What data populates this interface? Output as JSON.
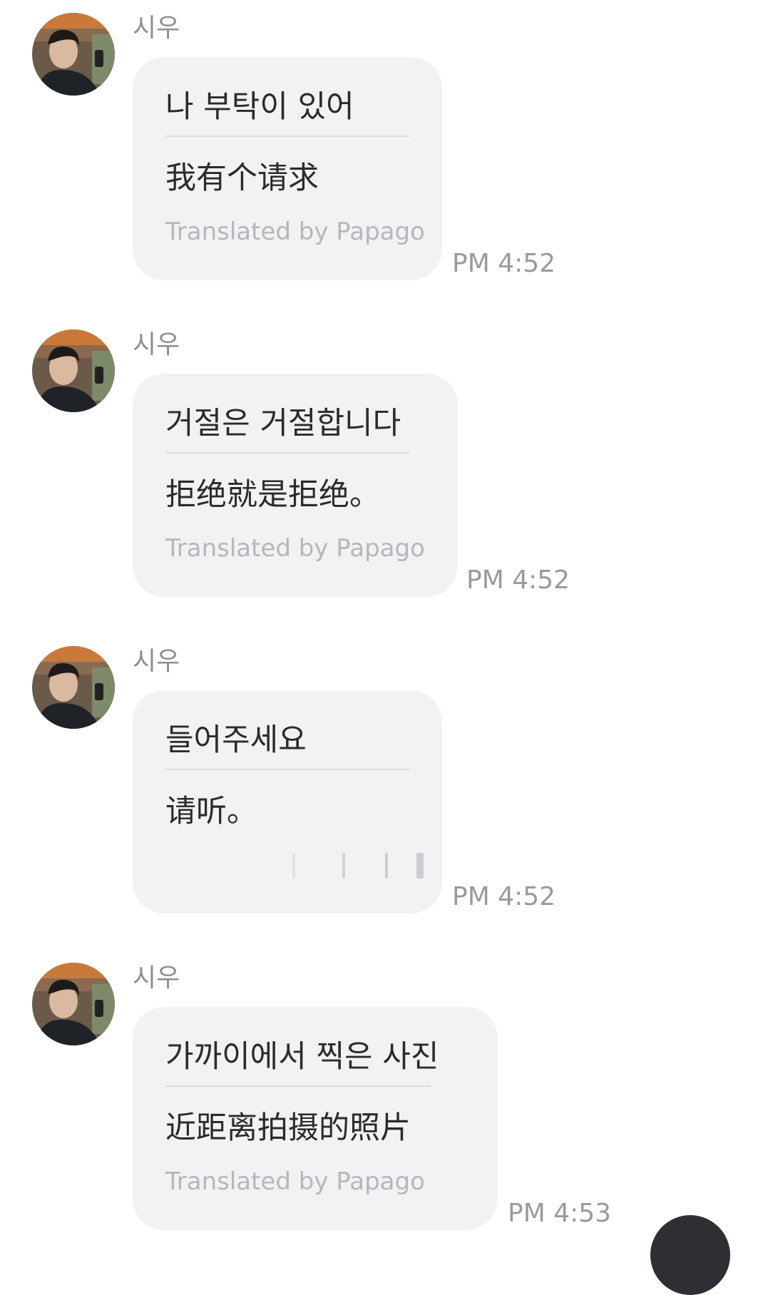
{
  "messages": [
    {
      "sender": "시우",
      "original": "나 부탁이 있어",
      "translation": "我有个请求",
      "credit": "Translated by Papago",
      "time": "PM 4:52"
    },
    {
      "sender": "시우",
      "original": "거절은 거절합니다",
      "translation": "拒绝就是拒绝。",
      "credit": "Translated by Papago",
      "time": "PM 4:52"
    },
    {
      "sender": "시우",
      "original": "들어주세요",
      "translation": "请听。",
      "credit": "",
      "time": "PM 4:52"
    },
    {
      "sender": "시우",
      "original": "가까이에서 찍은 사진",
      "translation": "近距离拍摄的照片",
      "credit": "Translated by Papago",
      "time": "PM 4:53"
    }
  ],
  "icons": {
    "avatar": "profile-photo",
    "fab": "scroll-down-button"
  }
}
